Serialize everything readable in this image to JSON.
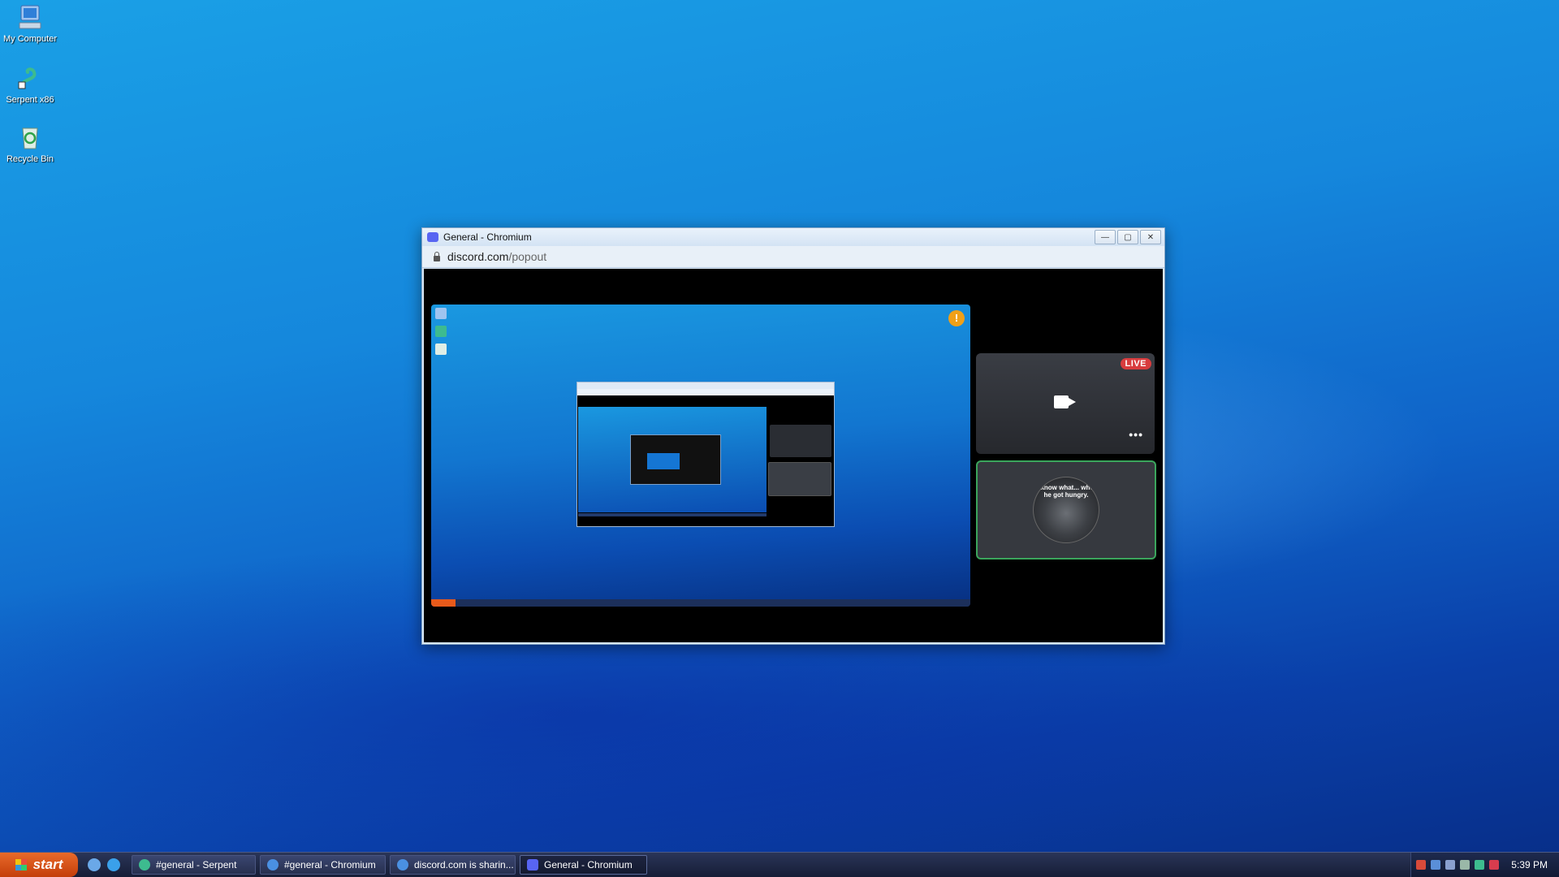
{
  "desktop": {
    "icons": [
      {
        "label": "My Computer"
      },
      {
        "label": "Serpent x86"
      },
      {
        "label": "Recycle Bin"
      }
    ]
  },
  "window": {
    "title": "General - Chromium",
    "url_domain": "discord.com",
    "url_path": "/popout",
    "controls": {
      "minimize": "—",
      "maximize": "▢",
      "close": "✕"
    }
  },
  "stream": {
    "alert_glyph": "!",
    "live_badge": "LIVE",
    "more_glyph": "•••",
    "avatar_caption": "u know what... when he got hungry."
  },
  "taskbar": {
    "start_label": "start",
    "tasks": [
      {
        "label": "#general - Serpent",
        "state": "inactive"
      },
      {
        "label": "#general - Chromium",
        "state": "inactive"
      },
      {
        "label": "discord.com is sharin...",
        "state": "inactive"
      },
      {
        "label": "General - Chromium",
        "state": "active"
      }
    ],
    "clock": "5:39 PM"
  },
  "colors": {
    "desktop_top": "#1aa0e6",
    "desktop_bottom": "#072d86",
    "discord_blurple": "#5865f2",
    "live_red": "#d83c3e",
    "speaking_green": "#3ba55c",
    "start_orange": "#e86a2a"
  }
}
